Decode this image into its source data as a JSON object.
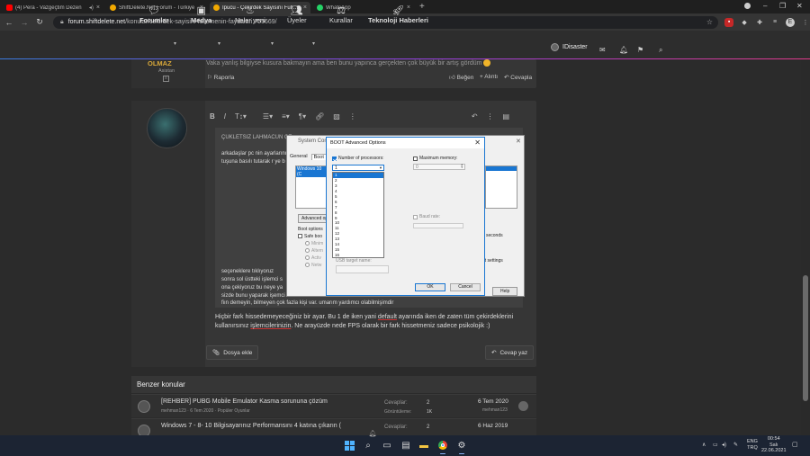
{
  "browser": {
    "tabs": [
      {
        "title": "(4) Pera - Vazgeçtim Dezen",
        "color": "#ff0000",
        "active": false
      },
      {
        "title": "ShiftDelete.Net Forum - Türkiye",
        "color": "#f2a900",
        "active": false
      },
      {
        "title": "İpucu - Çekirdek Sayısını Fullemenin",
        "color": "#f2a900",
        "active": true
      },
      {
        "title": "WhatsApp",
        "color": "#25d366",
        "active": false
      }
    ],
    "url_host": "forum.shiftdelete.net",
    "url_path": "/konular/cekirdek-sayisini-fullemenin-faydalari.755669/"
  },
  "site": {
    "nav": [
      {
        "label": "Forumlar",
        "icon": "chat-icon",
        "bold": true
      },
      {
        "label": "Medya",
        "icon": "media-icon",
        "bold": true
      },
      {
        "label": "Neler yeni",
        "icon": "bulb-icon",
        "bold": true
      },
      {
        "label": "Üyeler",
        "icon": "users-icon",
        "bold": true
      },
      {
        "label": "Kurallar",
        "icon": "scale-icon",
        "bold": true
      },
      {
        "label": "Teknoloji Haberleri",
        "icon": "rocket-icon",
        "bold": true
      }
    ],
    "username": "IDisaster"
  },
  "prev_post": {
    "rank": "OLMAZ",
    "role": "Asistan",
    "text": "Vaka yanlış bilgiyse kusura bakmayın ama ben bunu yapınca gerçekten çok büyük bir artış gördüm",
    "report": "Raporla",
    "like": "Beğen",
    "quote": "+ Alıntı",
    "reply": "Cevapla"
  },
  "editor": {
    "heading": "ÇUKLETSIZ LAHMACUN ÇE",
    "line1": "arkadaşlar pc nin ayarlarını",
    "line2": "tuşuna basılı tutarak r ye b",
    "line3": "seçeneklere tıklıyoruz",
    "line4": "sonra sol üstteki işlemci s",
    "line5": "ona çekiyoruz bu neye ya",
    "line6": "sizde bunu yaparak işemci",
    "line7": "fiın demeyin, bilmeyen çok fazla kişi var. umarım yardımcı olabilmişimdir"
  },
  "syscfg": {
    "title": "System Confi",
    "tabs": [
      "General",
      "Boot"
    ],
    "list_item": "Windows 10 (C",
    "advanced": "Advanced op",
    "boot_options": "Boot options",
    "safe_boot": "Safe boo",
    "opts": [
      "Minim",
      "Altern",
      "Activ",
      "Netw"
    ],
    "seconds": "seconds",
    "settings": "ot settings",
    "help": "Help"
  },
  "boot_dialog": {
    "title": "BOOT Advanced Options",
    "num_proc_label": "Number of processors:",
    "num_proc_checked": true,
    "selected": "1",
    "options": [
      "1",
      "2",
      "3",
      "4",
      "5",
      "6",
      "7",
      "8",
      "9",
      "10",
      "11",
      "12",
      "13",
      "14",
      "15",
      "16"
    ],
    "max_mem_label": "Maximum memory:",
    "max_mem_value": "0",
    "baud_label": "Baud rate:",
    "target_label": "USB target name:",
    "ok": "OK",
    "cancel": "Cancel"
  },
  "post_body": {
    "line1_a": "Hiçbir fark hissedemeyeceğiniz bir ayar. Bu 1 de iken yani ",
    "line1_u": "default",
    "line1_b": " ayarında iken de zaten tüm çekirdeklerini",
    "line2_a": "kullanırsınız ",
    "line2_u": "işlemcilerinizin",
    "line2_b": ". Ne arayüzde nede FPS olarak bir fark hissetmeniz sadece psikolojik :)"
  },
  "buttons": {
    "attach": "Dosya ekle",
    "reply": "Cevap yaz"
  },
  "similar": {
    "header": "Benzer konular",
    "rows": [
      {
        "title": "[REHBER] PUBG Mobile Emulator Kasma sorununa çözüm",
        "sub": "mehman123 · 6 Tem 2020 · Popüler Oyunlar",
        "l1": "Cevaplar:",
        "v1": "2",
        "l2": "Görüntüleme:",
        "v2": "1K",
        "date": "6 Tem 2020",
        "user": "mehman123"
      },
      {
        "title": "Windows 7 - 8- 10 Bilgisayarınız Performansını 4 katına çıkarın (",
        "sub": "",
        "l1": "Cevaplar:",
        "v1": "2",
        "l2": "",
        "v2": "",
        "date": "6 Haz 2019",
        "user": ""
      }
    ]
  },
  "taskbar": {
    "lang": "ENG",
    "lang2": "TRQ",
    "time": "00:54",
    "day": "Salı",
    "date": "22.06.2021"
  }
}
